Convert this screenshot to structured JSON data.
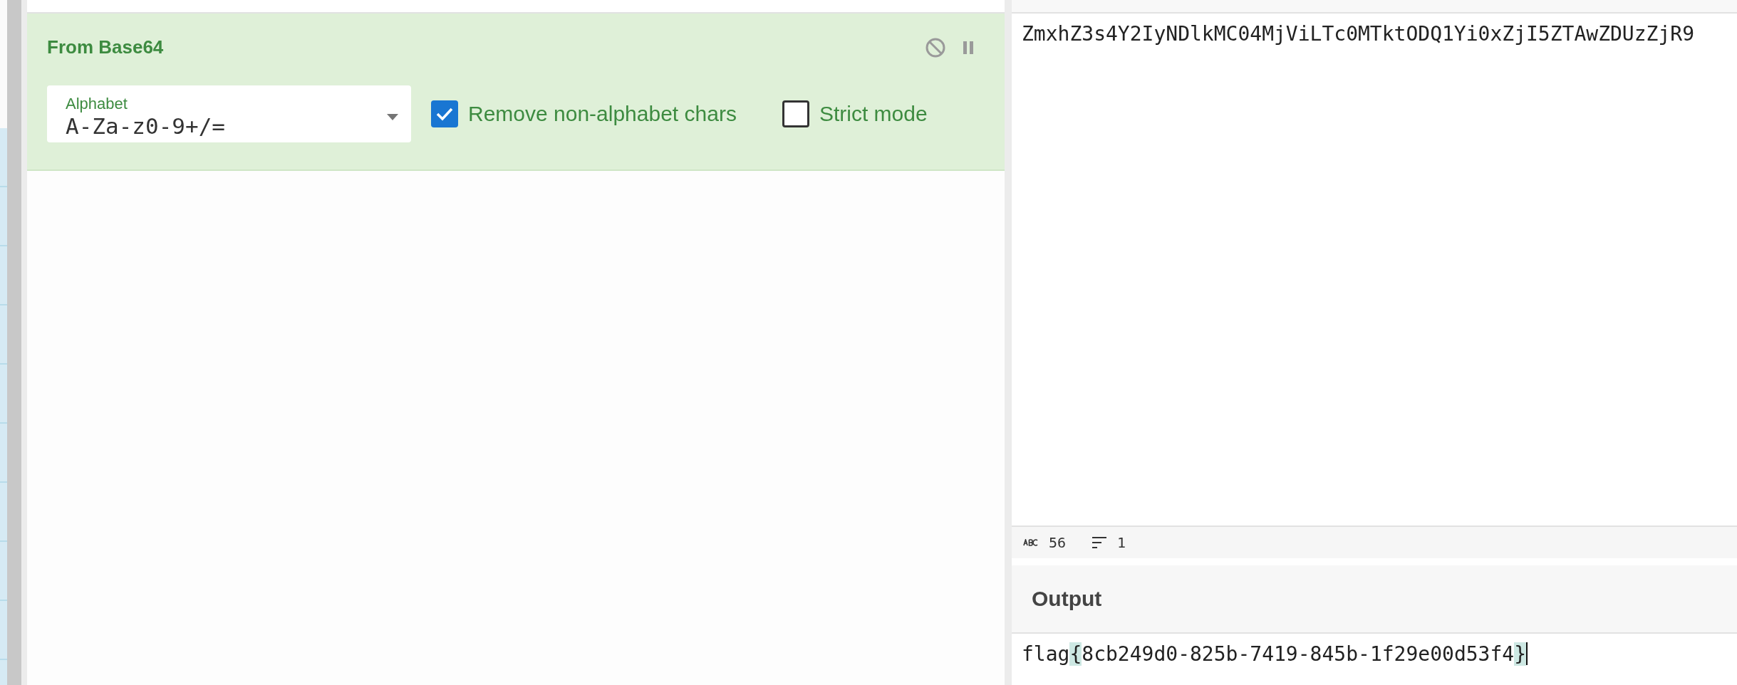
{
  "recipe": {
    "operations": [
      {
        "title": "From Base64",
        "disabled": false,
        "paused": false,
        "alphabet": {
          "label": "Alphabet",
          "value": "A-Za-z0-9+/="
        },
        "options": [
          {
            "label": "Remove non-alphabet chars",
            "checked": true
          },
          {
            "label": "Strict mode",
            "checked": false
          }
        ]
      }
    ]
  },
  "input": {
    "text": "ZmxhZ3s4Y2IyNDlkMC04MjViLTc0MTktODQ1Yi0xZjI5ZTAwZDUzZjR9",
    "status": {
      "length": "56",
      "lines": "1"
    }
  },
  "output": {
    "title": "Output",
    "caret": true,
    "segments": [
      {
        "text": "flag",
        "highlighted": false
      },
      {
        "text": "{",
        "highlighted": true
      },
      {
        "text": "8cb249d0-825b-7419-845b-1f29e00d53f4",
        "highlighted": false
      },
      {
        "text": "}",
        "highlighted": true
      }
    ]
  }
}
